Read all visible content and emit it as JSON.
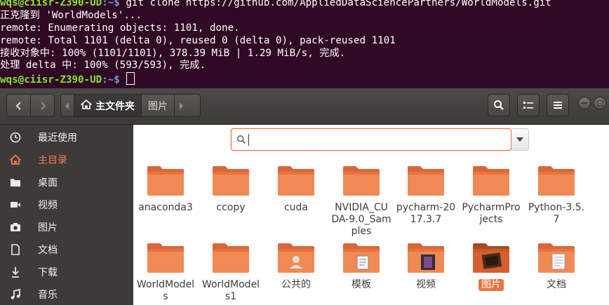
{
  "terminal": {
    "lines": [
      {
        "user": "wqs@ciisr-Z390-UD",
        "path": ":~$",
        "text": " git clone https://github.com/AppliedDataSciencePartners/WorldModels.git"
      },
      {
        "text": "正克隆到 'WorldModels'..."
      },
      {
        "text": "remote: Enumerating objects: 1101, done."
      },
      {
        "text": "remote: Total 1101 (delta 0), reused 0 (delta 0), pack-reused 1101"
      },
      {
        "text": "接收对象中: 100% (1101/1101), 378.39 MiB | 1.29 MiB/s, 完成."
      },
      {
        "text": "处理 delta 中: 100% (593/593), 完成."
      },
      {
        "user": "wqs@ciisr-Z390-UD",
        "path": ":~$",
        "text": " "
      }
    ]
  },
  "filemanager": {
    "path": {
      "home": "主文件夹",
      "next": "图片"
    },
    "search": {
      "placeholder": ""
    },
    "sidebar": [
      {
        "label": "最近使用",
        "icon": "recent-icon"
      },
      {
        "label": "主目录",
        "icon": "home-icon",
        "active": true
      },
      {
        "label": "桌面",
        "icon": "desktop-icon"
      },
      {
        "label": "视频",
        "icon": "videos-icon"
      },
      {
        "label": "图片",
        "icon": "pictures-icon"
      },
      {
        "label": "文档",
        "icon": "documents-icon"
      },
      {
        "label": "下载",
        "icon": "downloads-icon"
      },
      {
        "label": "音乐",
        "icon": "music-icon"
      }
    ],
    "items": [
      {
        "label": "anaconda3",
        "type": "folder"
      },
      {
        "label": "ccopy",
        "type": "folder"
      },
      {
        "label": "cuda",
        "type": "folder"
      },
      {
        "label": "NVIDIA_CUDA-9.0_Samples",
        "type": "folder"
      },
      {
        "label": "pycharm-2017.3.7",
        "type": "folder"
      },
      {
        "label": "PycharmProjects",
        "type": "folder"
      },
      {
        "label": "Python-3.5.7",
        "type": "folder"
      },
      {
        "label": "WorldModels",
        "type": "folder"
      },
      {
        "label": "WorldModels1",
        "type": "folder"
      },
      {
        "label": "公共的",
        "type": "public"
      },
      {
        "label": "模板",
        "type": "templates"
      },
      {
        "label": "视频",
        "type": "videos"
      },
      {
        "label": "图片",
        "type": "pictures",
        "selected": true
      },
      {
        "label": "文档",
        "type": "documents"
      }
    ]
  },
  "colors": {
    "accent": "#e9743f",
    "sidebar": "#3c3b37",
    "terminal_bg": "#300a24"
  }
}
